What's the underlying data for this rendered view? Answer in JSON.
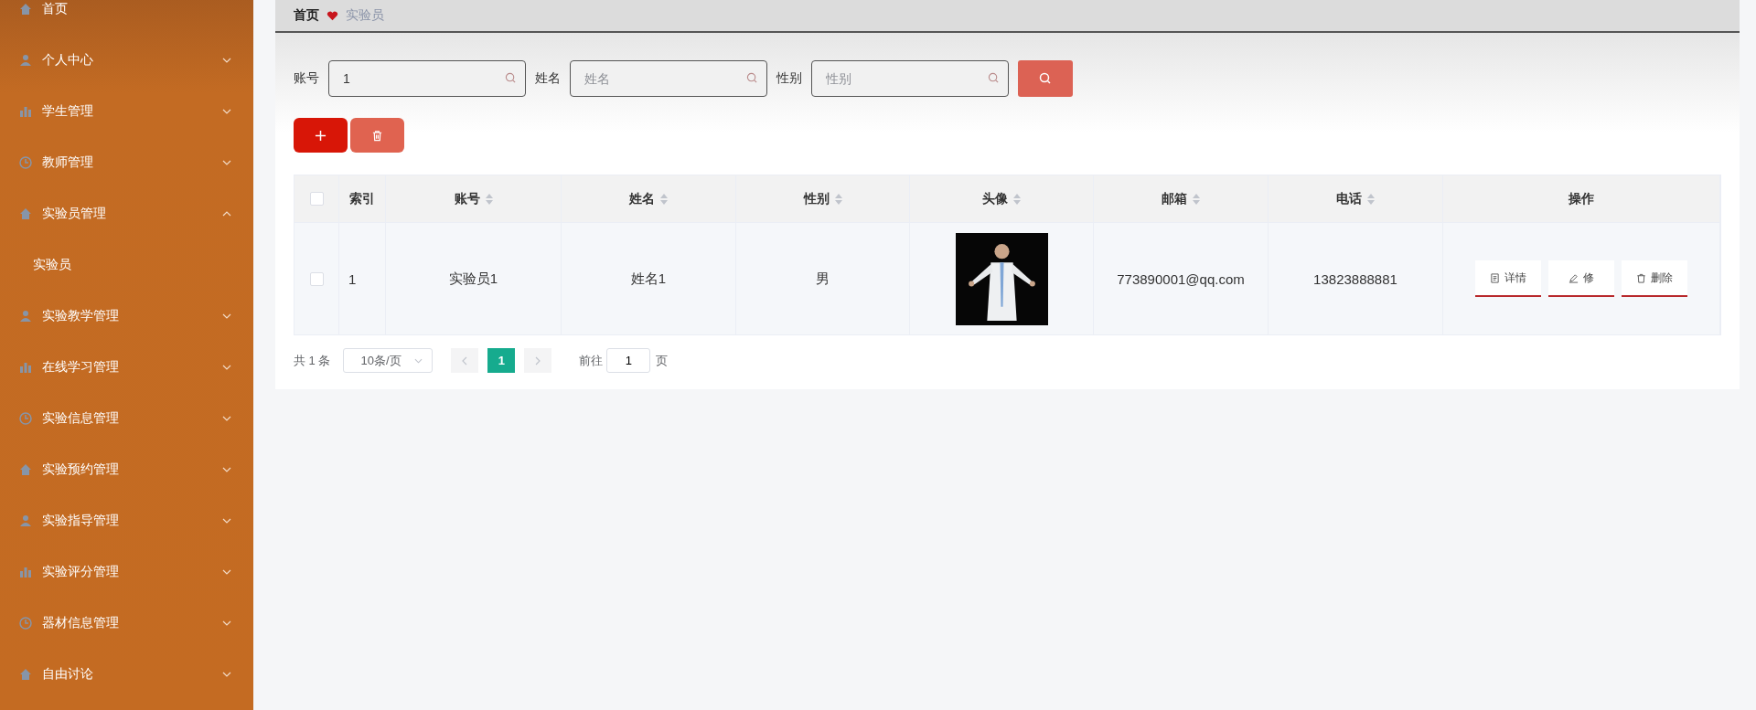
{
  "sidebar": {
    "items": [
      {
        "label": "首页"
      },
      {
        "label": "个人中心",
        "expanded": false
      },
      {
        "label": "学生管理",
        "expanded": false
      },
      {
        "label": "教师管理",
        "expanded": false
      },
      {
        "label": "实验员管理",
        "expanded": true,
        "children": [
          {
            "label": "实验员"
          }
        ]
      },
      {
        "label": "实验教学管理",
        "expanded": false
      },
      {
        "label": "在线学习管理",
        "expanded": false
      },
      {
        "label": "实验信息管理",
        "expanded": false
      },
      {
        "label": "实验预约管理",
        "expanded": false
      },
      {
        "label": "实验指导管理",
        "expanded": false
      },
      {
        "label": "实验评分管理",
        "expanded": false
      },
      {
        "label": "器材信息管理",
        "expanded": false
      },
      {
        "label": "自由讨论",
        "expanded": false
      }
    ]
  },
  "breadcrumb": {
    "home": "首页",
    "current": "实验员"
  },
  "search": {
    "fields": [
      {
        "label": "账号",
        "value": "1"
      },
      {
        "label": "姓名",
        "placeholder": "姓名"
      },
      {
        "label": "性别",
        "placeholder": "性别"
      }
    ]
  },
  "table": {
    "all_checked": false,
    "columns": [
      {
        "kind": "checkbox"
      },
      {
        "label": "索引",
        "kind": "text",
        "sortable": false
      },
      {
        "label": "账号",
        "kind": "text",
        "sortable": true
      },
      {
        "label": "姓名",
        "kind": "text",
        "sortable": true
      },
      {
        "label": "性别",
        "kind": "text",
        "sortable": true
      },
      {
        "label": "头像",
        "kind": "picture",
        "sortable": true
      },
      {
        "label": "邮箱",
        "kind": "text",
        "sortable": true
      },
      {
        "label": "电话",
        "kind": "text",
        "sortable": true
      },
      {
        "label": "操作",
        "kind": "actions",
        "sortable": false
      }
    ],
    "rows": [
      {
        "checked": false,
        "cells": [
          "",
          "1",
          "实验员1",
          "姓名1",
          "男",
          "",
          "773890001@qq.com",
          "13823888881",
          ""
        ],
        "actions": [
          {
            "kind": "detail",
            "label": "详情"
          },
          {
            "kind": "edit",
            "label": "修"
          },
          {
            "kind": "delete",
            "label": "删除"
          }
        ]
      }
    ]
  },
  "pagination": {
    "total": "共 1 条",
    "page_size": "10条/页",
    "pages": [
      {
        "label": "1",
        "selected": true
      }
    ],
    "goto_label": "前往",
    "goto_value": "1",
    "page_suffix": "页"
  }
}
